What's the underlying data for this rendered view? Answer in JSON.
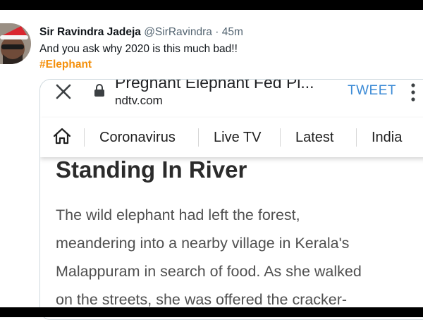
{
  "tweet": {
    "author_name": "Sir Ravindra Jadeja",
    "author_handle": "@SirRavindra",
    "separator": "·",
    "time": "45m",
    "text": "And you ask why 2020 is this much bad!!",
    "hashtag": "#Elephant"
  },
  "browser": {
    "page_title": "Pregnant Elephant Fed Pi...",
    "domain": "ndtv.com",
    "action_label": "TWEET"
  },
  "nav": {
    "items": [
      "Coronavirus",
      "Live TV",
      "Latest",
      "India"
    ]
  },
  "article": {
    "heading": "Standing In River",
    "lines": [
      "The wild elephant had left the forest,",
      "meandering into a nearby village in Kerala's",
      "Malappuram in search of food. As she walked",
      "on the streets, she was offered the cracker-"
    ]
  },
  "icons": {
    "avatar": "avatar-santa-hat",
    "close": "close-icon",
    "lock": "lock-icon",
    "more": "more-vertical-icon",
    "home": "home-icon"
  },
  "colors": {
    "hashtag": "#f4900c",
    "tweet_action": "#3c8bd6",
    "muted": "#536471"
  }
}
